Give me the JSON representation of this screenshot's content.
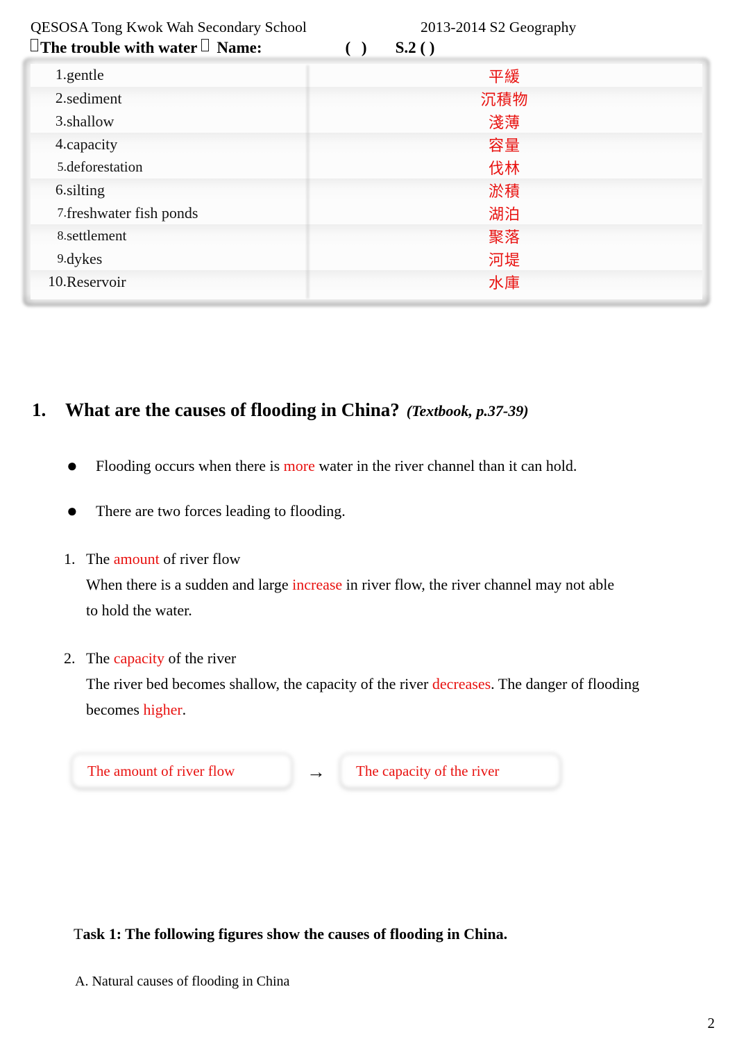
{
  "header": {
    "school": "QESOSA Tong Kwok Wah Secondary School",
    "course": "2013-2014 S2 Geography",
    "topic": "The trouble with water",
    "name_label": "Name:",
    "class_paren": "(    )",
    "class_label": "S.2 (    )"
  },
  "vocabulary": {
    "rows": [
      {
        "num": "1.",
        "english": "gentle",
        "chinese": "平緩"
      },
      {
        "num": "2.",
        "english": "sediment",
        "chinese": "沉積物"
      },
      {
        "num": "3.",
        "english": "shallow",
        "chinese": "淺薄"
      },
      {
        "num": "4.",
        "english": "capacity",
        "chinese": "容量"
      },
      {
        "num": "5.",
        "english": "deforestation",
        "chinese": "伐林"
      },
      {
        "num": "6.",
        "english": "silting",
        "chinese": "淤積"
      },
      {
        "num": "7.",
        "english": "freshwater fish ponds",
        "chinese": "湖泊"
      },
      {
        "num": "8.",
        "english": "settlement",
        "chinese": "聚落"
      },
      {
        "num": "9.",
        "english": "dykes",
        "chinese": "河堤"
      },
      {
        "num": "10.",
        "english": "Reservoir",
        "chinese": "水庫"
      }
    ]
  },
  "section": {
    "number": "1.",
    "title": "What are the causes of flooding in China?",
    "reference": "(Textbook, p.37-39)"
  },
  "bullets": [
    {
      "marker": "●",
      "before": "Flooding occurs when there is ",
      "highlight": "more",
      "after": " water in the river channel than it can hold."
    },
    {
      "marker": "●",
      "before": "There are two forces leading to flooding.",
      "highlight": "",
      "after": ""
    }
  ],
  "forces": [
    {
      "num": "1.",
      "line1_before": "The ",
      "line1_highlight": "amount",
      "line1_after": " of river flow",
      "line2_before": "When there is a sudden and large ",
      "line2_highlight": "increase",
      "line2_after": " in river flow, the river channel may not able",
      "line3": "to hold the water."
    },
    {
      "num": "2.",
      "line1_before": "The ",
      "line1_highlight": "capacity",
      "line1_after": " of the river",
      "line2_before": "The river bed becomes shallow, the capacity of the river ",
      "line2_highlight": "decreases",
      "line2_after": ". The danger of flooding",
      "line3_before": "becomes ",
      "line3_highlight": "higher",
      "line3_after": "."
    }
  ],
  "flow": {
    "box1": "The amount of river flow",
    "arrow": "→",
    "box2": "The capacity of the river"
  },
  "task": {
    "lead": "T",
    "title": "ask 1: The following figures show the causes of flooding in China.",
    "subtitle": "A. Natural causes of flooding in China"
  },
  "footer": {
    "page_number": "2"
  },
  "colors": {
    "red": "#e8110f",
    "text": "#111111"
  }
}
